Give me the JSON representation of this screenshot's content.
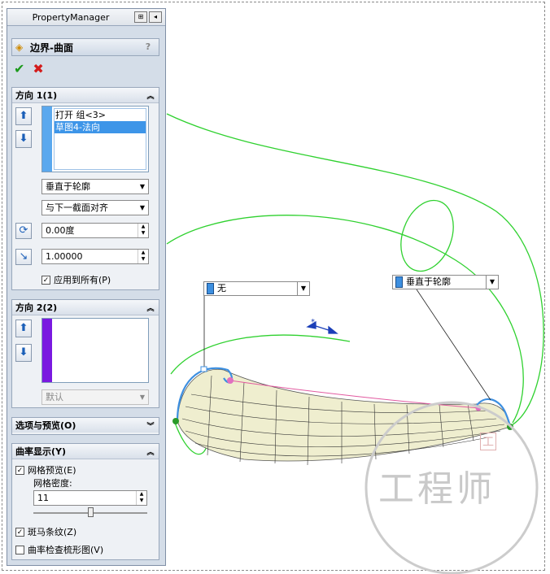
{
  "panel": {
    "title": "PropertyManager",
    "feature_title": "边界-曲面",
    "help": "?",
    "ok_icon": "check-icon",
    "cancel_icon": "cross-icon",
    "direction1": {
      "header": "方向 1(1)",
      "items": [
        "打开 组<3>",
        "草图4-法向"
      ],
      "selected_index": 1,
      "tangent_type": "垂直于轮廓",
      "alignment": "与下一截面对齐",
      "angle": "0.00度",
      "length": "1.00000",
      "apply_all": "应用到所有(P)",
      "apply_all_checked": true,
      "strip_color": "#5aa8ee"
    },
    "direction2": {
      "header": "方向 2(2)",
      "items": [],
      "tangent_type": "默认",
      "strip_color": "#7a19e0"
    },
    "options": {
      "header": "选项与预览(O)"
    },
    "curvature": {
      "header": "曲率显示(Y)",
      "mesh_preview": "网格预览(E)",
      "mesh_preview_checked": true,
      "mesh_density_label": "网格密度:",
      "mesh_density": "11",
      "mesh_density_fraction": 0.5,
      "zebra": "斑马条纹(Z)",
      "zebra_checked": true,
      "curvature_comb": "曲率检查梳形图(V)",
      "curvature_comb_checked": false
    }
  },
  "viewport": {
    "callout_left": "无",
    "callout_right": "垂直于轮廓",
    "watermark": "工程师",
    "colors": {
      "curve": "#2fd12f",
      "profile": "#3d8fe0",
      "mesh": "#222222"
    }
  }
}
